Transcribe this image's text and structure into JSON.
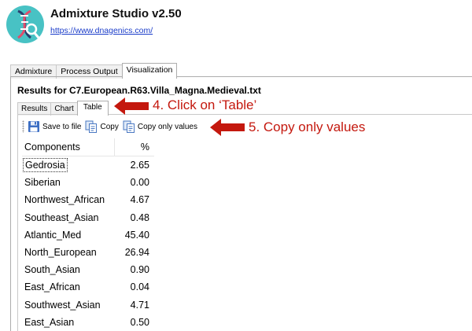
{
  "app": {
    "title": "Admixture Studio v2.50",
    "link": "https://www.dnagenics.com/"
  },
  "main_tabs": [
    "Admixture",
    "Process Output",
    "Visualization"
  ],
  "results_title": "Results for C7.European.R63.Villa_Magna.Medieval.txt",
  "sub_tabs": [
    "Results",
    "Chart",
    "Table"
  ],
  "toolbar": {
    "save": "Save to file",
    "copy": "Copy",
    "copy_values": "Copy only values"
  },
  "annotations": {
    "step4": "4. Click on ‘Table’",
    "step5": "5. Copy only values",
    "color": "#c4180e"
  },
  "table": {
    "headers": [
      "Components",
      "%"
    ],
    "rows": [
      {
        "name": "Gedrosia",
        "value": "2.65"
      },
      {
        "name": "Siberian",
        "value": "0.00"
      },
      {
        "name": "Northwest_African",
        "value": "4.67"
      },
      {
        "name": "Southeast_Asian",
        "value": "0.48"
      },
      {
        "name": "Atlantic_Med",
        "value": "45.40"
      },
      {
        "name": "North_European",
        "value": "26.94"
      },
      {
        "name": "South_Asian",
        "value": "0.90"
      },
      {
        "name": "East_African",
        "value": "0.04"
      },
      {
        "name": "Southwest_Asian",
        "value": "4.71"
      },
      {
        "name": "East_Asian",
        "value": "0.50"
      }
    ]
  }
}
